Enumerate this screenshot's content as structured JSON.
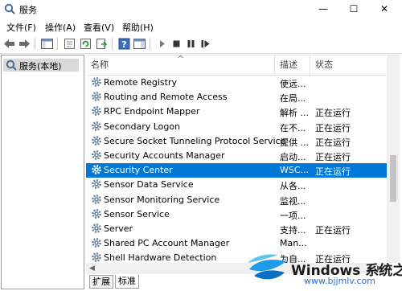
{
  "window": {
    "title": "服务",
    "minimize": "—",
    "maximize": "☐",
    "close": "✕"
  },
  "menu": [
    "文件(F)",
    "操作(A)",
    "查看(V)",
    "帮助(H)"
  ],
  "left_pane": {
    "item": "服务(本地)"
  },
  "columns": {
    "name": "名称",
    "desc": "描述",
    "status": "状态"
  },
  "services": [
    {
      "name": "Remote Registry",
      "desc": "使远...",
      "status": ""
    },
    {
      "name": "Routing and Remote Access",
      "desc": "在局...",
      "status": ""
    },
    {
      "name": "RPC Endpoint Mapper",
      "desc": "解析 ...",
      "status": "正在运行"
    },
    {
      "name": "Secondary Logon",
      "desc": "在不...",
      "status": "正在运行"
    },
    {
      "name": "Secure Socket Tunneling Protocol Service",
      "desc": "提供 ...",
      "status": "正在运行"
    },
    {
      "name": "Security Accounts Manager",
      "desc": "启动...",
      "status": "正在运行"
    },
    {
      "name": "Security Center",
      "desc": "WSC...",
      "status": "正在运行",
      "selected": true
    },
    {
      "name": "Sensor Data Service",
      "desc": "从各...",
      "status": ""
    },
    {
      "name": "Sensor Monitoring Service",
      "desc": "监视...",
      "status": ""
    },
    {
      "name": "Sensor Service",
      "desc": "一项...",
      "status": ""
    },
    {
      "name": "Server",
      "desc": "支持...",
      "status": "正在运行"
    },
    {
      "name": "Shared PC Account Manager",
      "desc": "Man...",
      "status": ""
    },
    {
      "name": "Shell Hardware Detection",
      "desc": "为自...",
      "status": "正在运行"
    }
  ],
  "tabs": [
    "扩展",
    "标准"
  ],
  "watermark": {
    "brand": "Windows",
    "cn": "系统之家",
    "url": "www.bjjmlv.com"
  },
  "colors": {
    "selection": "#0078d7",
    "header_text": "#555555"
  }
}
